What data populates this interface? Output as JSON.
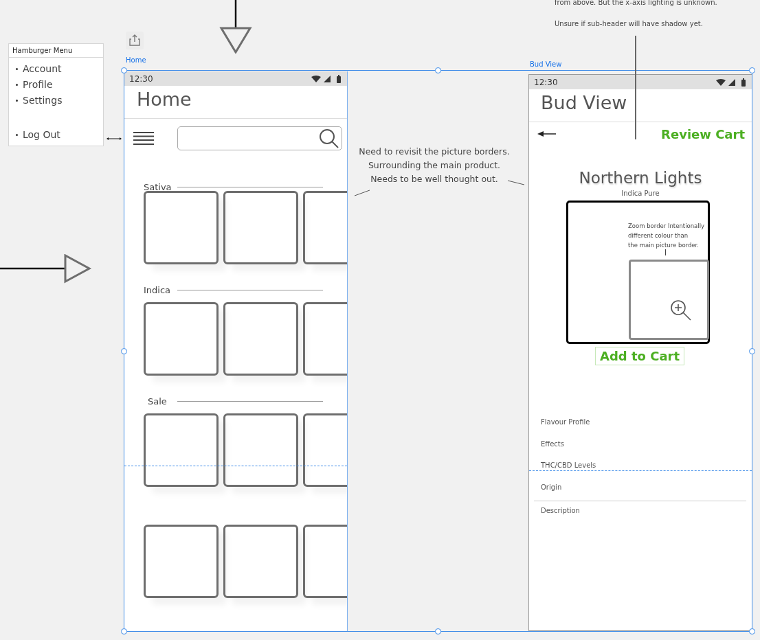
{
  "top_note": {
    "lines": [
      "from above. But the x-axis lighting is unknown.",
      "Unsure if sub-header will have shadow yet."
    ]
  },
  "hamburger_menu": {
    "title": "Hamburger Menu",
    "items": [
      "Account",
      "Profile",
      "Settings"
    ],
    "footer_item": "Log Out"
  },
  "home_artboard": {
    "label": "Home",
    "status_time": "12:30",
    "title": "Home",
    "shelves": [
      {
        "label": "Sativa"
      },
      {
        "label": "Indica"
      },
      {
        "label": "Sale"
      }
    ]
  },
  "side_note": {
    "lines": [
      "Need to revisit the picture borders.",
      "Surrounding the main product.",
      "Needs to be well thought out."
    ]
  },
  "bud_view_artboard": {
    "label": "Bud View",
    "status_time": "12:30",
    "title": "Bud View",
    "review_cart": "Review Cart",
    "product_name": "Northern Lights",
    "product_type": "Indica Pure",
    "zoom_note": [
      "Zoom border Intentionally",
      "different colour than",
      "the main picture border."
    ],
    "add_to_cart": "Add to Cart",
    "details": [
      "Flavour Profile",
      "Effects",
      "THC/CBD Levels",
      "Origin"
    ],
    "description": "Description"
  }
}
